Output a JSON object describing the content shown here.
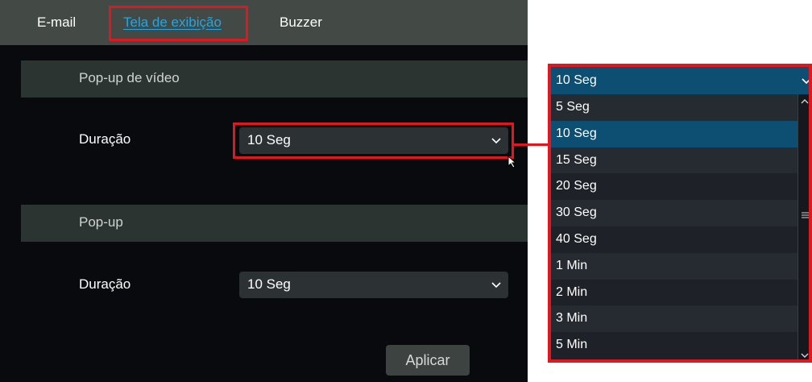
{
  "tabs": [
    {
      "label": "E-mail"
    },
    {
      "label": "Tela de exibição"
    },
    {
      "label": "Buzzer"
    }
  ],
  "sections": {
    "video_popup": {
      "title": "Pop-up de vídeo",
      "duration_label": "Duração",
      "duration_value": "10 Seg"
    },
    "popup": {
      "title": "Pop-up",
      "duration_label": "Duração",
      "duration_value": "10 Seg"
    }
  },
  "apply_label": "Aplicar",
  "dropdown": {
    "selected": "10 Seg",
    "options": [
      "5 Seg",
      "10 Seg",
      "15 Seg",
      "20 Seg",
      "30 Seg",
      "40 Seg",
      "1 Min",
      "2 Min",
      "3 Min",
      "5 Min"
    ]
  },
  "colors": {
    "highlight": "#e0171f",
    "active_tab": "#23a6e3",
    "selected_option": "#0c4f73"
  }
}
